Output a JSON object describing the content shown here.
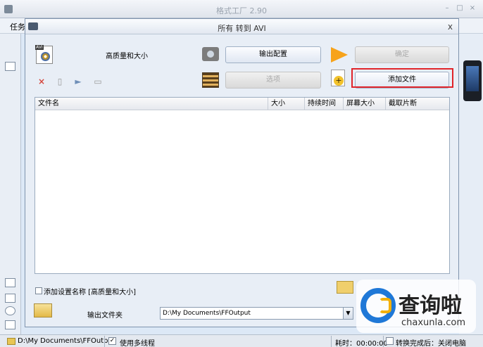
{
  "app": {
    "title": "格式工厂 2.90",
    "menu_label": "任务"
  },
  "dialog": {
    "title": "所有 转到 AVI",
    "quality_label": "高质量和大小",
    "output_config_label": "输出配置",
    "options_label": "选项",
    "ok_label": "确定",
    "add_file_label": "添加文件",
    "close_glyph": "x"
  },
  "table": {
    "columns": [
      "文件名",
      "大小",
      "持续时间",
      "屏幕大小",
      "截取片断"
    ],
    "rows": []
  },
  "settings": {
    "add_setting_name_label": "添加设置名称 [高质量和大小]",
    "output_folder_label": "输出文件夹",
    "output_folder_value": "D:\\My Documents\\FFOutput"
  },
  "statusbar": {
    "path": "D:\\My Documents\\FFOutput",
    "multithread_label": "使用多线程",
    "multithread_checked": "✓",
    "time_label": "耗时：00:00:00",
    "after_convert_label": "转换完成后：关闭电脑"
  },
  "watermark": {
    "cn": "查询啦",
    "en": "chaxunla.com"
  },
  "icons": {
    "delete": "×",
    "play": "►",
    "highlight_color": "#e0242a"
  }
}
